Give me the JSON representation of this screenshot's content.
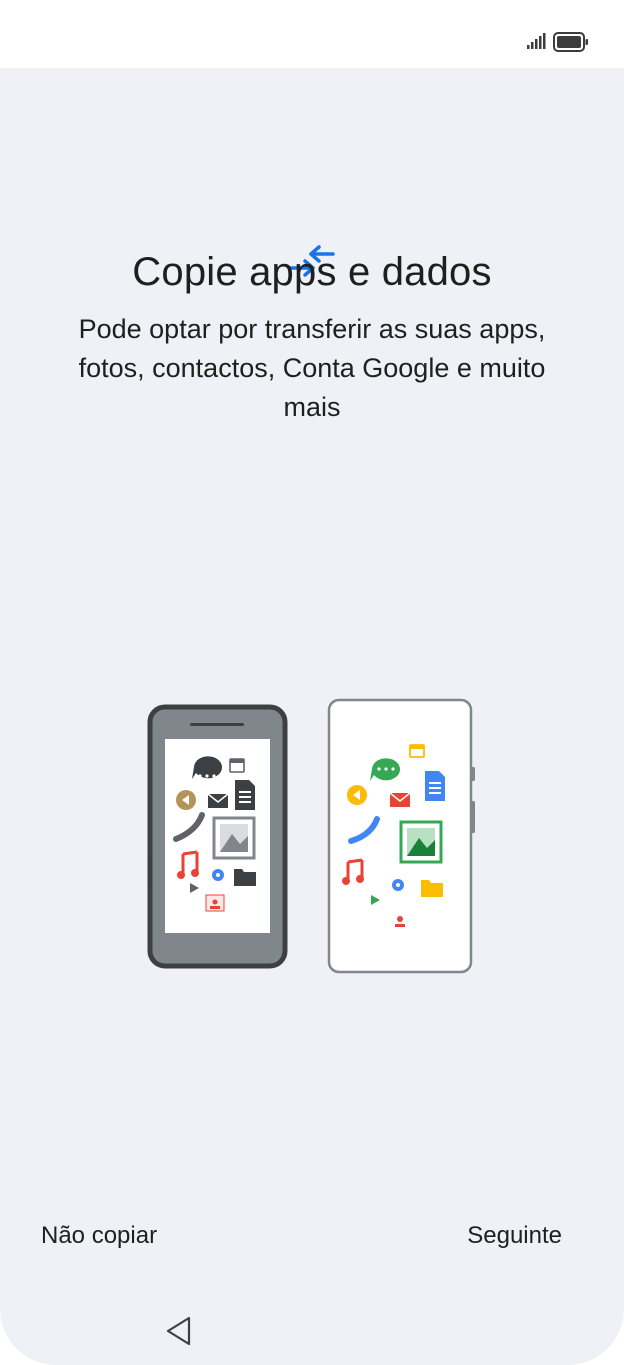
{
  "status_bar": {
    "signal_icon": "signal-icon",
    "battery_icon": "battery-icon"
  },
  "header": {
    "icon": "transfer-arrows-icon",
    "title": "Copie apps e dados",
    "subtitle": "Pode optar por transferir as suas apps, fotos, contactos, Conta Google e muito mais"
  },
  "illustration": {
    "name": "two-phones-transfer-illustration",
    "colors": {
      "old_phone": "#3c4043",
      "new_phone_border": "#80868b",
      "blue": "#4285f4",
      "green": "#34a853",
      "red": "#ea4335",
      "yellow": "#fbbc04"
    }
  },
  "footer": {
    "left_label": "Não copiar",
    "right_label": "Seguinte"
  },
  "nav": {
    "back_icon": "back-triangle-icon"
  }
}
